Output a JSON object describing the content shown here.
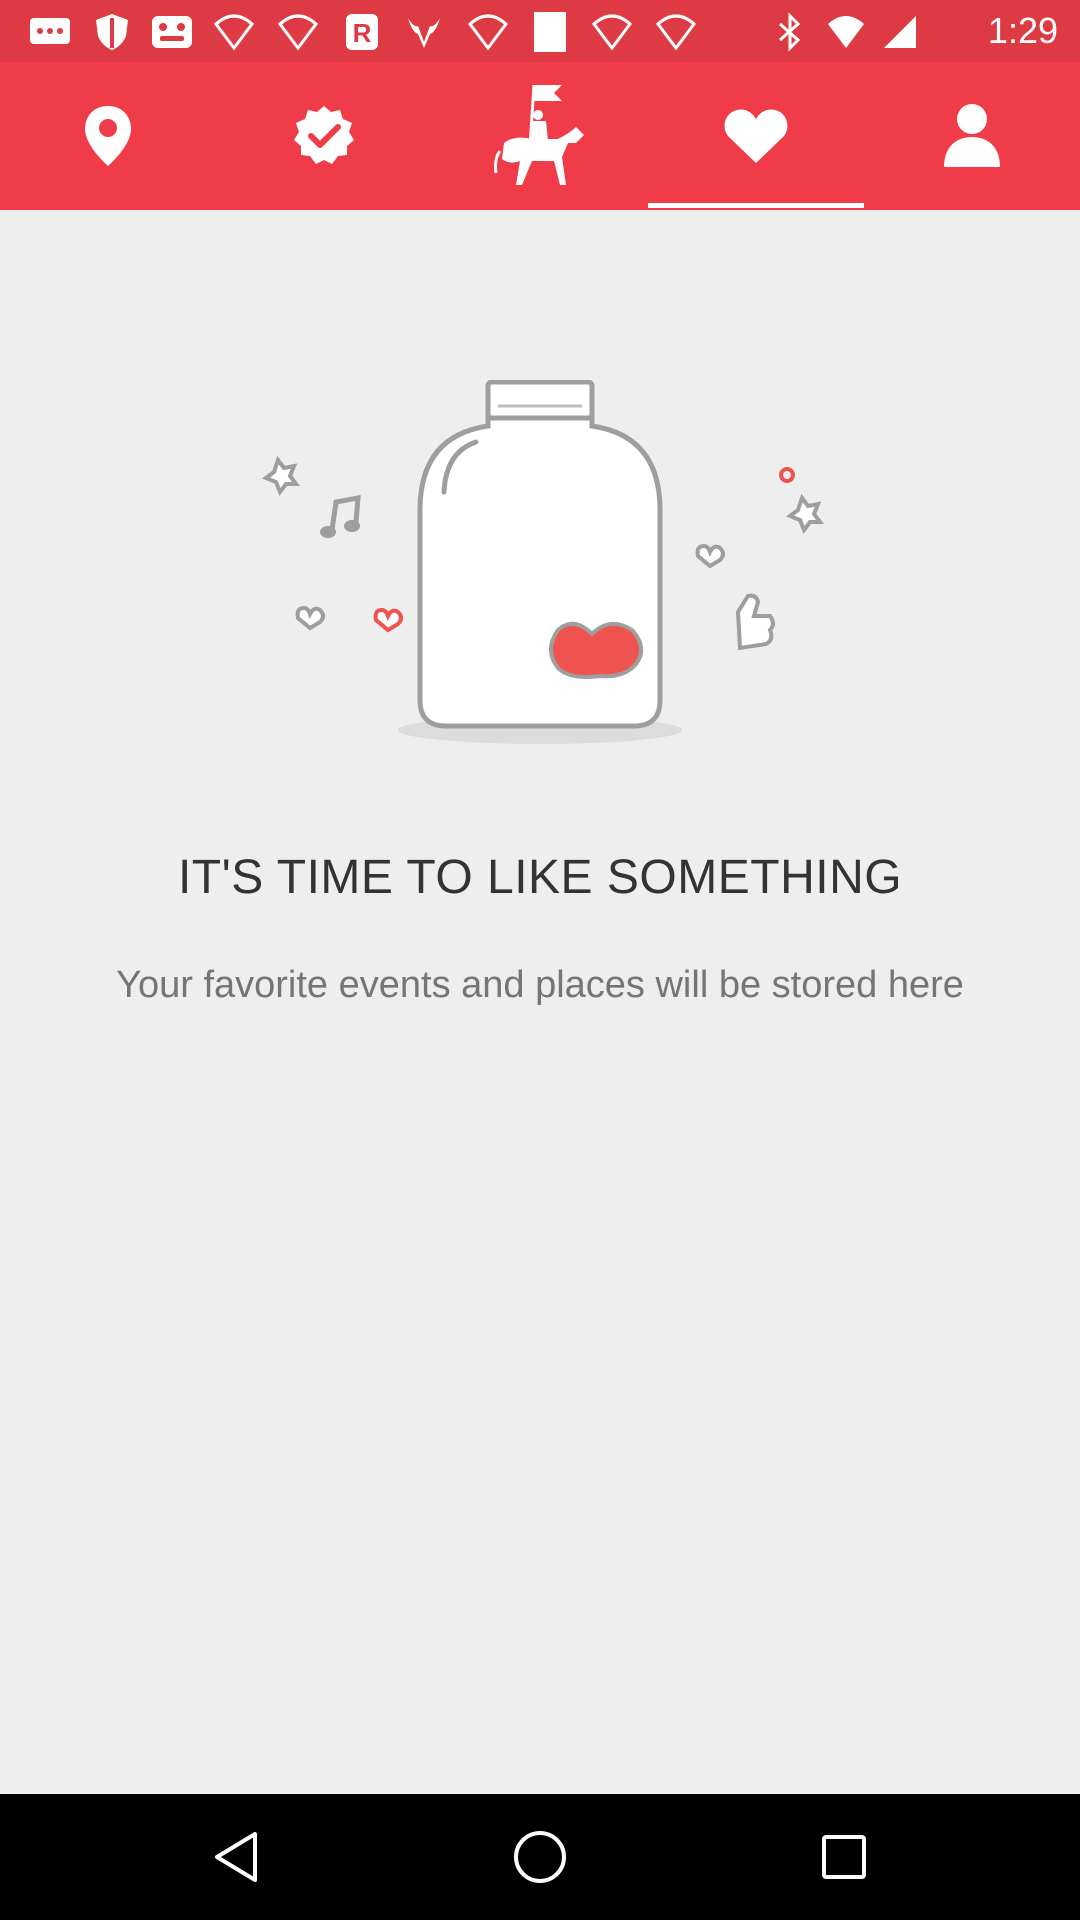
{
  "status_bar": {
    "time": "1:29",
    "icons": [
      "messages-icon",
      "shield-icon",
      "game-icon",
      "wifi-icon",
      "wifi-icon",
      "r-app-icon",
      "bull-icon",
      "wifi-icon",
      "blank-app-icon",
      "wifi-icon",
      "wifi-icon",
      "bluetooth-icon",
      "wifi-icon",
      "signal-icon"
    ]
  },
  "tabs": [
    {
      "name": "location",
      "icon": "map-pin-icon",
      "selected": false
    },
    {
      "name": "verified",
      "icon": "check-badge-icon",
      "selected": false
    },
    {
      "name": "events",
      "icon": "rider-flag-icon",
      "selected": false
    },
    {
      "name": "favorites",
      "icon": "heart-icon",
      "selected": true
    },
    {
      "name": "profile",
      "icon": "person-icon",
      "selected": false
    }
  ],
  "empty_state": {
    "title": "IT'S TIME TO LIKE SOMETHING",
    "subtitle": "Your favorite events and places will be stored here",
    "illustration": "jar-with-heart-icon"
  },
  "nav_bar": {
    "buttons": [
      "back-icon",
      "home-icon",
      "recents-icon"
    ]
  },
  "colors": {
    "status_bar": "#dd3a44",
    "tab_bar": "#ef3c48",
    "background": "#eeeeee",
    "accent": "#ef5350"
  }
}
